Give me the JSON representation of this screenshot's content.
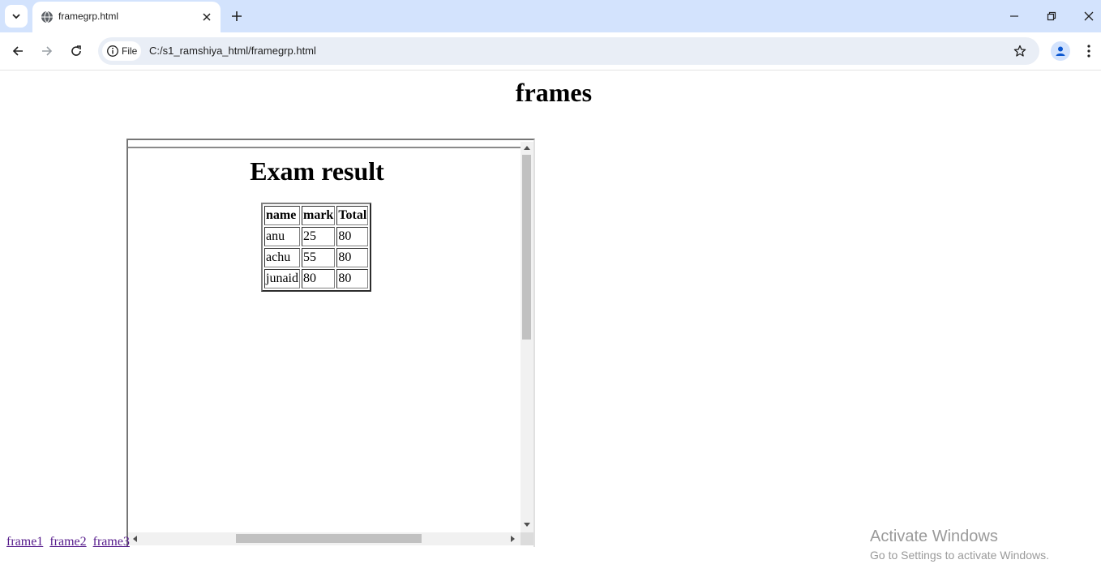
{
  "browser": {
    "tab_title": "framegrp.html",
    "site_chip": "File",
    "url": "C:/s1_ramshiya_html/framegrp.html"
  },
  "icons": {
    "tab_list": "chevron-down-icon",
    "tab_favicon": "globe-icon",
    "tab_close": "close-icon",
    "new_tab": "plus-icon",
    "minimize": "minimize-icon",
    "restore": "restore-icon",
    "close_window": "close-icon",
    "back": "arrow-left-icon",
    "forward": "arrow-right-icon",
    "reload": "reload-icon",
    "site_info": "info-icon",
    "bookmark": "star-icon",
    "profile": "person-icon",
    "menu": "more-vert-icon"
  },
  "page": {
    "heading": "frames",
    "frame": {
      "title": "Exam result",
      "table": {
        "headers": [
          "name",
          "mark",
          "Total"
        ],
        "rows": [
          [
            "anu",
            "25",
            "80"
          ],
          [
            "achu",
            "55",
            "80"
          ],
          [
            "junaid",
            "80",
            "80"
          ]
        ]
      }
    },
    "links": [
      "frame1",
      "frame2",
      "frame3"
    ]
  },
  "watermark": {
    "line1": "Activate Windows",
    "line2": "Go to Settings to activate Windows."
  },
  "colors": {
    "tabstrip": "#d3e3fd",
    "omnibox": "#e9eef6",
    "visited_link": "#551a8b"
  }
}
